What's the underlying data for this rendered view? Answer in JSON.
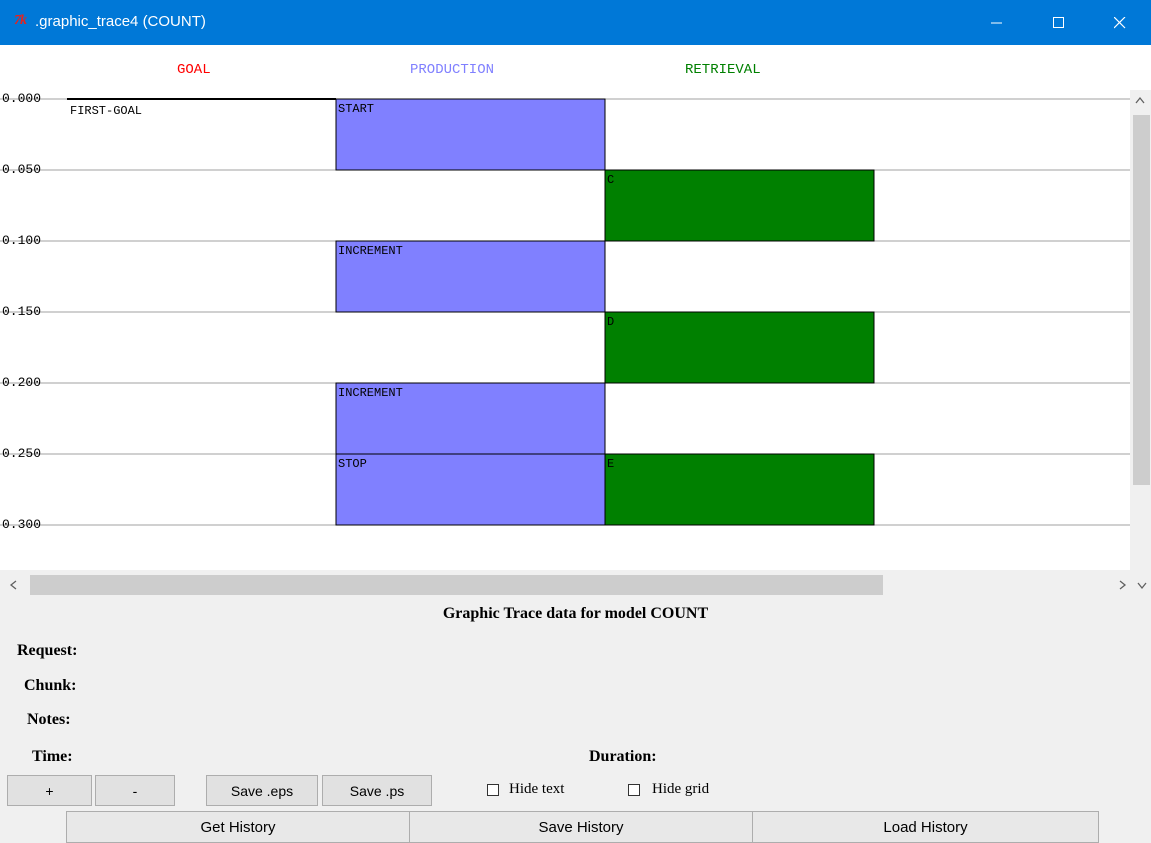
{
  "window": {
    "icon_text": "7k",
    "title": ".graphic_trace4 (COUNT)"
  },
  "columns": {
    "goal": "GOAL",
    "production": "PRODUCTION",
    "retrieval": "RETRIEVAL"
  },
  "column_colors": {
    "goal": "#ff0000",
    "production": "#8080ff",
    "retrieval": "#008000"
  },
  "time_axis": {
    "ticks": [
      "0.000",
      "0.050",
      "0.100",
      "0.150",
      "0.200",
      "0.250",
      "0.300"
    ]
  },
  "trace": {
    "goal": [
      {
        "label": "FIRST-GOAL",
        "start": 0.0
      }
    ],
    "production": [
      {
        "label": "START",
        "start": 0.0,
        "end": 0.05
      },
      {
        "label": "INCREMENT",
        "start": 0.1,
        "end": 0.15
      },
      {
        "label": "INCREMENT",
        "start": 0.2,
        "end": 0.25
      },
      {
        "label": "STOP",
        "start": 0.25,
        "end": 0.3
      }
    ],
    "retrieval": [
      {
        "label": "C",
        "start": 0.05,
        "end": 0.1
      },
      {
        "label": "D",
        "start": 0.15,
        "end": 0.2
      },
      {
        "label": "E",
        "start": 0.25,
        "end": 0.3
      }
    ]
  },
  "caption": "Graphic Trace data for model COUNT",
  "info": {
    "request": "Request:",
    "chunk": "Chunk:",
    "notes": "Notes:",
    "time": "Time:",
    "duration": "Duration:"
  },
  "buttons": {
    "plus": "+",
    "minus": "-",
    "save_eps": "Save .eps",
    "save_ps": "Save .ps"
  },
  "checkboxes": {
    "hide_text": "Hide text",
    "hide_grid": "Hide grid"
  },
  "history": {
    "get": "Get History",
    "save": "Save History",
    "load": "Load History"
  }
}
